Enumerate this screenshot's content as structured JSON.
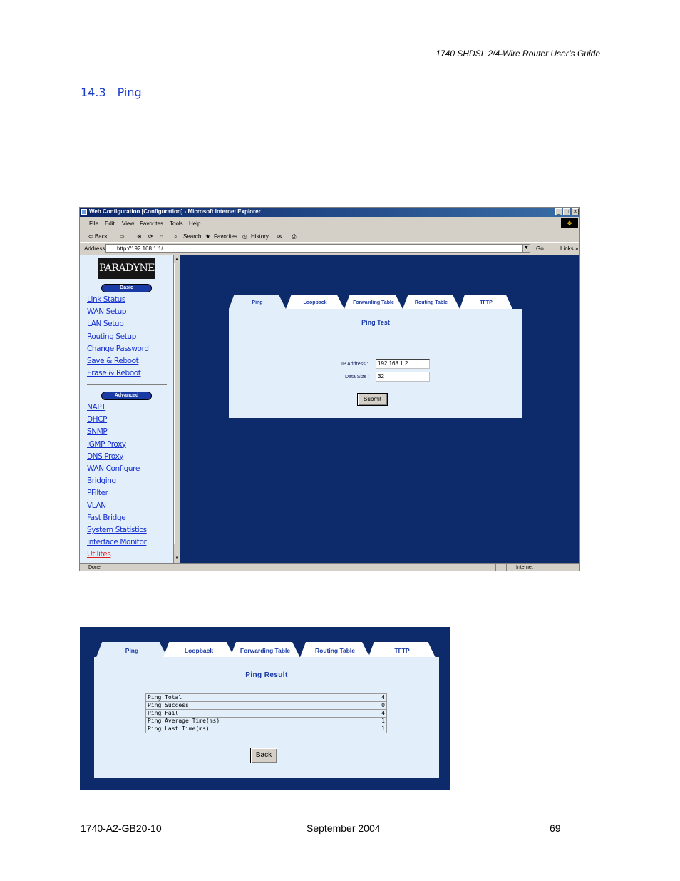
{
  "document": {
    "running_header": "1740 SHDSL 2/4-Wire Router User’s Guide",
    "section_number": "14.3",
    "section_title": "Ping",
    "footer": {
      "doc_number": "1740-A2-GB20-10",
      "date": "September 2004",
      "page": "69"
    }
  },
  "browser": {
    "title": "Web Configuration [Configuration] - Microsoft Internet Explorer",
    "window_buttons": [
      "_",
      "□",
      "×"
    ],
    "menu": [
      "File",
      "Edit",
      "View",
      "Favorites",
      "Tools",
      "Help"
    ],
    "toolbar": {
      "back": "⇦ Back",
      "forward": "⇨",
      "search": "Search",
      "favorites": "Favorites",
      "history": "History"
    },
    "address_label": "Address",
    "address_value": "http://192.168.1.1/",
    "go_label": "Go",
    "links_label": "Links »",
    "status_text": "Done",
    "status_zone": "Internet"
  },
  "sidebar": {
    "logo": "PARADYNE",
    "basic_label": "Basic",
    "basic_items": [
      "Link Status",
      "WAN Setup",
      "LAN Setup",
      "Routing Setup",
      "Change Password",
      "Save & Reboot",
      "Erase & Reboot"
    ],
    "advanced_label": "Advanced",
    "advanced_items": [
      "NAPT",
      "DHCP",
      "SNMP",
      "IGMP Proxy",
      "DNS Proxy",
      "WAN Configure",
      "Bridging",
      "PFilter",
      "VLAN",
      "Fast Bridge",
      "System Statistics",
      "Interface Monitor",
      "Utilites"
    ]
  },
  "tabs": [
    "Ping",
    "Loopback",
    "Forwarding Table",
    "Routing Table",
    "TFTP"
  ],
  "ping_test": {
    "title": "Ping Test",
    "ip_label": "IP Address :",
    "ip_value": "192.168.1.2",
    "size_label": "Data Size :",
    "size_value": "32",
    "submit_label": "Submit"
  },
  "ping_result": {
    "title": "Ping Result",
    "rows": [
      {
        "label": "Ping Total",
        "value": "4"
      },
      {
        "label": "Ping Success",
        "value": "0"
      },
      {
        "label": "Ping Fail",
        "value": "4"
      },
      {
        "label": "Ping Average Time(ms)",
        "value": "1"
      },
      {
        "label": "Ping Last Time(ms)",
        "value": "1"
      }
    ],
    "back_label": "Back"
  },
  "colors": {
    "frame_navy": "#0d2a6b",
    "panel": "#e2eefa",
    "link": "#1530d0",
    "active_link": "#e02020",
    "accent": "#1a3ccc"
  }
}
